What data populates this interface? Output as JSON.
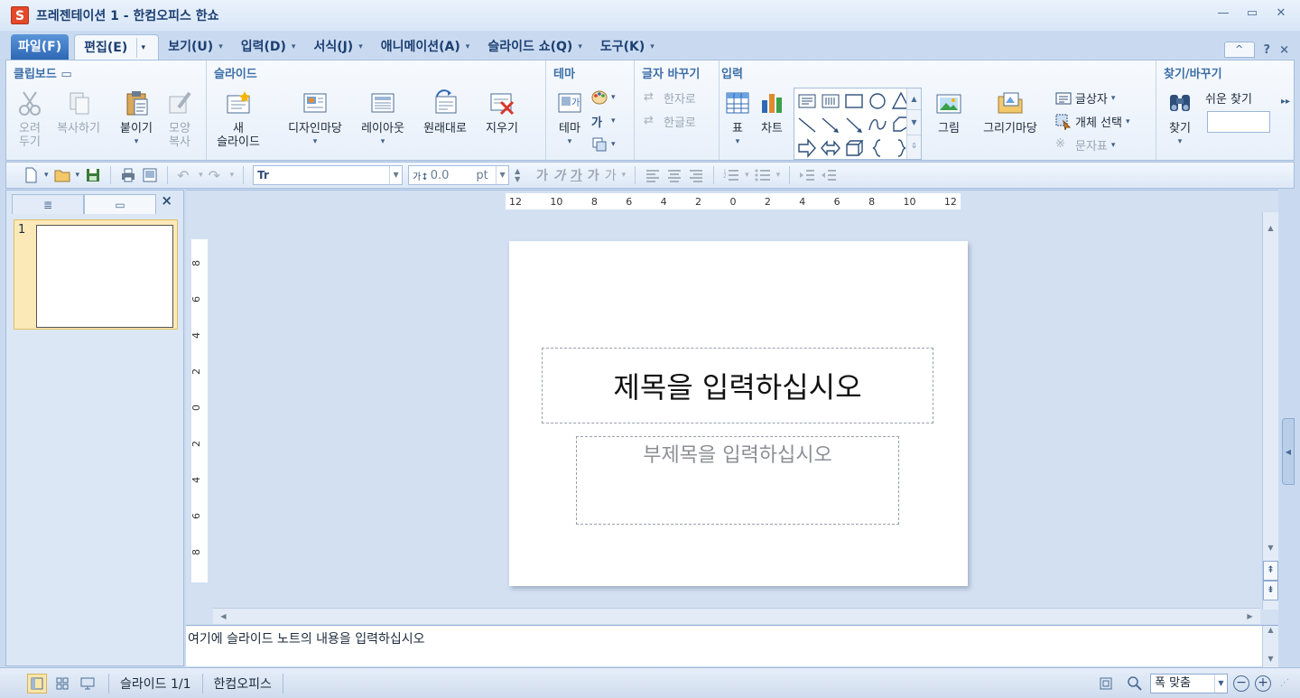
{
  "window": {
    "logo_letter": "S",
    "title": "프레젠테이션 1 - 한컴오피스 한쇼",
    "minimize": "—",
    "restore": "▭",
    "close": "✕"
  },
  "menu": {
    "file": "파일(F)",
    "tabs": [
      {
        "label": "편집(E)"
      },
      {
        "label": "보기(U)"
      },
      {
        "label": "입력(D)"
      },
      {
        "label": "서식(J)"
      },
      {
        "label": "애니메이션(A)"
      },
      {
        "label": "슬라이드 쇼(Q)"
      },
      {
        "label": "도구(K)"
      }
    ],
    "help": "?",
    "close": "×",
    "collapse": "^"
  },
  "ribbon": {
    "clipboard": {
      "title": "클립보드",
      "cut": "오려\n두기",
      "copy": "복사하기",
      "paste": "붙이기",
      "format_painter": "모양\n복사"
    },
    "slide": {
      "title": "슬라이드",
      "new_slide": "새\n슬라이드",
      "design": "디자인마당",
      "layout": "레이아웃",
      "reset": "원래대로",
      "delete": "지우기"
    },
    "theme": {
      "title": "테마",
      "theme": "테마"
    },
    "convert": {
      "title": "글자 바꾸기",
      "to_hanja": "한자로",
      "to_hangul": "한글로"
    },
    "insert": {
      "title": "입력",
      "table": "표",
      "chart": "차트",
      "picture": "그림",
      "drawing": "그리기마당",
      "textbox": "글상자",
      "object_select": "개체 선택",
      "symbol": "문자표"
    },
    "find": {
      "title": "찾기/바꾸기",
      "easy_find": "쉬운 찾기",
      "find": "찾기"
    }
  },
  "quickbar": {
    "font_icon": "Tr",
    "size_value": "0.0",
    "size_unit": "pt",
    "bold": "가",
    "italic": "가",
    "underline": "가",
    "strike": "가",
    "shadow": "가"
  },
  "ruler": {
    "h_ticks": [
      "12",
      "10",
      "8",
      "6",
      "4",
      "2",
      "0",
      "2",
      "4",
      "6",
      "8",
      "10",
      "12"
    ],
    "v_ticks": [
      "8",
      "6",
      "4",
      "2",
      "0",
      "2",
      "4",
      "6",
      "8"
    ]
  },
  "slides_panel": {
    "close": "×",
    "thumb_number": "1"
  },
  "slide": {
    "title_placeholder": "제목을 입력하십시오",
    "subtitle_placeholder": "부제목을 입력하십시오"
  },
  "notes": {
    "placeholder": "여기에 슬라이드 노트의 내용을 입력하십시오"
  },
  "status": {
    "slide_count": "슬라이드 1/1",
    "app_name": "한컴오피스",
    "zoom": "폭 맞춤",
    "zoom_out": "−",
    "zoom_in": "+"
  },
  "colors": {
    "accent": "#2e68b6",
    "group_title": "#3c6ea8",
    "selected_thumb": "#fbe9b7"
  }
}
